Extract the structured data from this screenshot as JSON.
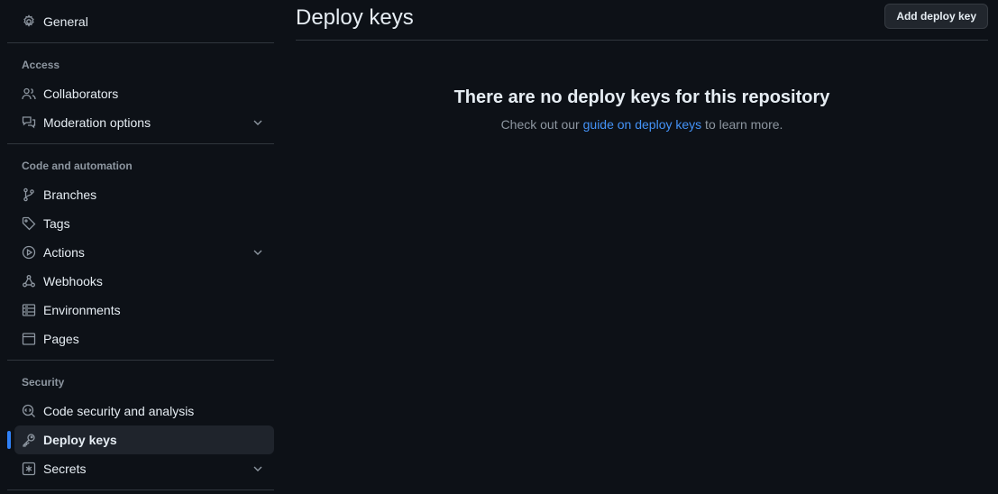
{
  "sidebar": {
    "general": {
      "label": "General",
      "icon": "gear-icon"
    },
    "sections": {
      "access": {
        "title": "Access"
      },
      "code_automation": {
        "title": "Code and automation"
      },
      "security": {
        "title": "Security"
      }
    },
    "items": {
      "collaborators": {
        "label": "Collaborators",
        "icon": "people-icon"
      },
      "moderation": {
        "label": "Moderation options",
        "icon": "comment-discussion-icon"
      },
      "branches": {
        "label": "Branches",
        "icon": "git-branch-icon"
      },
      "tags": {
        "label": "Tags",
        "icon": "tag-icon"
      },
      "actions": {
        "label": "Actions",
        "icon": "play-icon"
      },
      "webhooks": {
        "label": "Webhooks",
        "icon": "webhook-icon"
      },
      "environments": {
        "label": "Environments",
        "icon": "server-icon"
      },
      "pages": {
        "label": "Pages",
        "icon": "browser-icon"
      },
      "code_security": {
        "label": "Code security and analysis",
        "icon": "codescan-icon"
      },
      "deploy_keys": {
        "label": "Deploy keys",
        "icon": "key-icon",
        "active": true
      },
      "secrets": {
        "label": "Secrets",
        "icon": "asterisk-box-icon"
      }
    }
  },
  "main": {
    "title": "Deploy keys",
    "add_button": "Add deploy key",
    "empty": {
      "heading": "There are no deploy keys for this repository",
      "text_before": "Check out our ",
      "link": "guide on deploy keys",
      "text_after": " to learn more."
    }
  },
  "colors": {
    "background": "#0d1117",
    "text": "#e6edf3",
    "muted": "#8d96a0",
    "link": "#4493f8",
    "accent": "#2f81f7",
    "border": "#30363d",
    "active_bg": "#1f242c"
  }
}
